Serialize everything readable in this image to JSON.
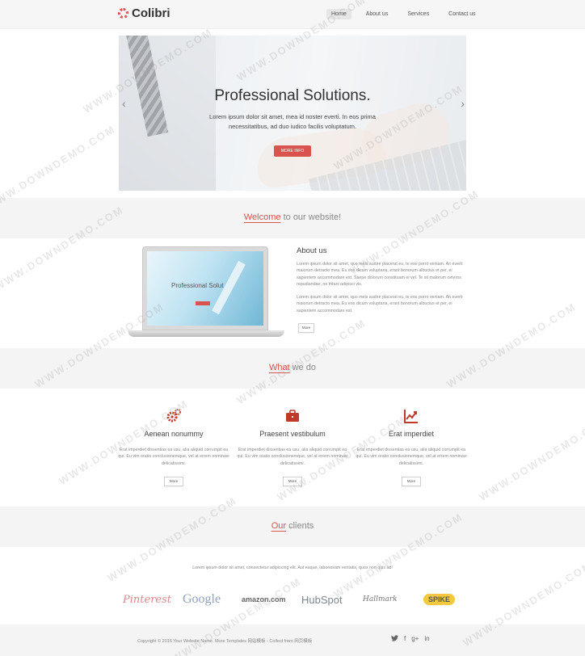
{
  "header": {
    "logo_text": "Colibri",
    "nav": [
      "Home",
      "About us",
      "Services",
      "Contact us"
    ]
  },
  "hero": {
    "title": "Professional Solutions.",
    "text": "Lorem ipsum dolor sit amet, mea id noster everti. In eos prima necessitatibus, ad duo iudico facilis voluptatum.",
    "button": "MORE INFO",
    "arrow_left": "‹",
    "arrow_right": "›"
  },
  "welcome": {
    "accent": "Welcome",
    "rest": " to our website!"
  },
  "about": {
    "title": "About us",
    "laptop_screen_title": "Professional Solut",
    "p1": "Lorem ipsum dolor sit amet, quo meis audire placerat eu, te eos porro veniam. An everti maiorum detracto mea. Eu eos dicam voluptaria, erant bonorum albucius et per, ei sapientem accommodare est. Saepe dolorum constituam ei vel. Te sit malorum ceteros repudiandae, ne tritani adipisci vis.",
    "p2": "Lorem ipsum dolor sit amet, quo meis audire placerat eu, te eos porro veniam. An everti maiorum detracto mea. Eu eos dicam voluptaria, erant bonorum albucius et per, ei sapientem accommodare est.",
    "button": "More"
  },
  "what_we_do": {
    "accent": "What",
    "rest": " we do",
    "items": [
      {
        "icon": "gears-icon",
        "title": "Aenean nonummy",
        "text": "Erat imperdiet dissentias ea usu, alia aliquid corrumpit ea qui. Eu vim oratio conclusionemque, vel at errem nominavi delicatissimi.",
        "button": "More"
      },
      {
        "icon": "briefcase-icon",
        "title": "Praesent vestibulum",
        "text": "Erat imperdiet dissentias ea usu, alia aliquid corrumpit ea qui. Eu vim oratio conclusionemque, vel at errem nominavi delicatissimi.",
        "button": "More"
      },
      {
        "icon": "chart-icon",
        "title": "Erat imperdiet",
        "text": "Erat imperdiet dissentias ea usu, alia aliquid corrumpit ea qui. Eu vim oratio conclusionemque, vel at errem nominavi delicatissimi.",
        "button": "More"
      }
    ]
  },
  "clients": {
    "accent": "Our",
    "rest": " clients",
    "text": "Lorem ipsum dolor sit amet, consectetur adipiscing elit. Aut eaque, laboriosam veritatis, quos non quis ad!",
    "logos": [
      "Pinterest",
      "Google",
      "amazon.com",
      "HubSpot",
      "Hallmark",
      "SPIKE"
    ]
  },
  "footer": {
    "copyright": "Copyright © 2016 Your Website Name. More Templates 网站模板 - Collect from 网页模板",
    "social": [
      "twitter-icon",
      "facebook-icon",
      "google-plus-icon",
      "linkedin-icon"
    ],
    "social_glyphs": [
      "🐦",
      "f",
      "g+",
      "in"
    ]
  },
  "watermark": "WWW.DOWNDEMO.COM",
  "colors": {
    "accent": "#d9534f",
    "band": "#f4f4f4"
  }
}
